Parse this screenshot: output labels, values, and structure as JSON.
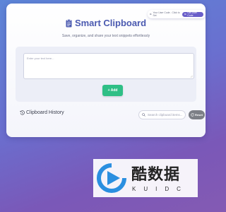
{
  "app": {
    "title": "Smart Clipboard",
    "subtitle": "Save, organize, and share your text snippets effortlessly"
  },
  "user": {
    "code_text": "Your User Code - Click to Set",
    "get_button": "Get User Code"
  },
  "input": {
    "placeholder": "Enter your text here...",
    "add_label": "+ Add"
  },
  "history": {
    "title": "Clipboard History",
    "search_placeholder": "Search clipboard items...",
    "reset_label": "Reset"
  },
  "watermark": {
    "cn": "酷数据",
    "en": "KUIDC"
  },
  "colors": {
    "accent": "#4b5ab0",
    "add_button": "#2fbf86",
    "reset_button": "#7c7f86",
    "get_code_button": "#6a5fc9"
  }
}
